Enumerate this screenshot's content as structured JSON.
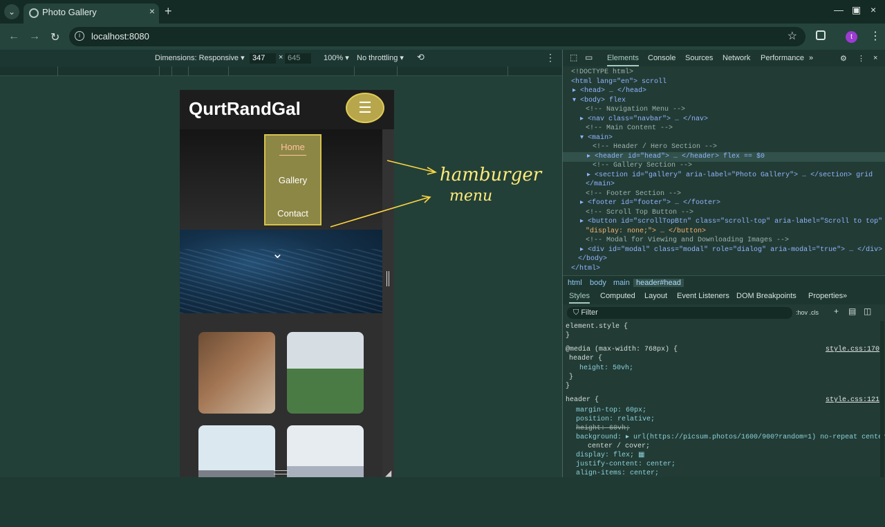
{
  "browser": {
    "tab_title": "Photo Gallery",
    "url": "localhost:8080",
    "avatar_letter": "t"
  },
  "devtools_bar": {
    "dimensions_label": "Dimensions: Responsive ▾",
    "width": "347",
    "height": "645",
    "zoom": "100% ▾",
    "throttle": "No throttling ▾"
  },
  "page": {
    "brand": "QurtRandGal",
    "menu": [
      "Home",
      "Gallery",
      "Contact"
    ]
  },
  "annotation": {
    "line1": "hamburger",
    "line2": "menu"
  },
  "devtools_tabs": [
    "Elements",
    "Console",
    "Sources",
    "Network",
    "Performance"
  ],
  "dom_lines": [
    "<!DOCTYPE html>",
    "<html lang=\"en\"> scroll",
    "▸ <head> … </head>",
    "▾ <body> flex",
    "<!-- Navigation Menu -->",
    "▸ <nav class=\"navbar\"> … </nav>",
    "<!-- Main Content -->",
    "▾ <main>",
    "<!-- Header / Hero Section -->",
    "▸ <header id=\"head\"> … </header> flex == $0",
    "<!-- Gallery Section -->",
    "▸ <section id=\"gallery\" aria-label=\"Photo Gallery\"> … </section> grid",
    "</main>",
    "<!-- Footer Section -->",
    "▸ <footer id=\"footer\"> … </footer>",
    "<!-- Scroll Top Button -->",
    "▸ <button id=\"scrollTopBtn\" class=\"scroll-top\" aria-label=\"Scroll to top\" style=",
    "\"display: none;\"> … </button>",
    "<!-- Modal for Viewing and Downloading Images -->",
    "▸ <div id=\"modal\" class=\"modal\" role=\"dialog\" aria-modal=\"true\"> … </div>",
    "</body>",
    "</html>"
  ],
  "breadcrumbs": [
    "html",
    "body",
    "main",
    "header#head"
  ],
  "style_tabs": [
    "Styles",
    "Computed",
    "Layout",
    "Event Listeners",
    "DOM Breakpoints",
    "Properties"
  ],
  "filter_placeholder": "Filter",
  "style_tools": ":hov .cls",
  "styles": [
    "element.style {",
    "}",
    "@media (max-width: 768px) {",
    "header {",
    "height: 50vh;",
    "}",
    "}",
    "header {",
    "margin-top: 60px;",
    "position: relative;",
    "height: 60vh;",
    "background: ▸ url(https://picsum.photos/1600/900?random=1) no-repeat center",
    "center / cover;",
    "display: flex; ▦",
    "justify-content: center;",
    "align-items: center;"
  ],
  "style_sources": [
    "style.css:170",
    "style.css:121"
  ]
}
